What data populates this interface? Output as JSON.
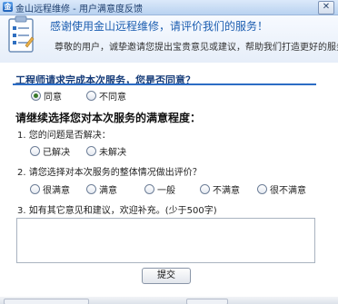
{
  "window": {
    "title": "金山远程维修 - 用户满意度反馈",
    "close_glyph": "✕"
  },
  "banner": {
    "title": "感谢使用金山远程维修，请评价我们的服务！",
    "subtitle": "尊敬的用户，诚挚邀请您提出宝贵意见或建议，帮助我们打造更好的服务。"
  },
  "q_completed": {
    "label": "工程师请求完成本次服务，您是否同意？",
    "options": [
      "同意",
      "不同意"
    ],
    "selected": "同意"
  },
  "survey": {
    "title": "请继续选择您对本次服务的满意程度：",
    "q1": {
      "label": "1. 您的问题是否解决：",
      "options": [
        "已解决",
        "未解决"
      ]
    },
    "q2": {
      "label": "2. 请您选择对本次服务的整体情况做出评价？",
      "options": [
        "很满意",
        "满意",
        "一般",
        "不满意",
        "很不满意"
      ]
    },
    "q3": {
      "label": "3. 如有其它意见和建议，欢迎补充。(少于500字)",
      "value": ""
    }
  },
  "submit_label": "提交",
  "colors": {
    "accent": "#1b5db0",
    "rule": "#2b6cc4",
    "heading": "#173d7a"
  }
}
